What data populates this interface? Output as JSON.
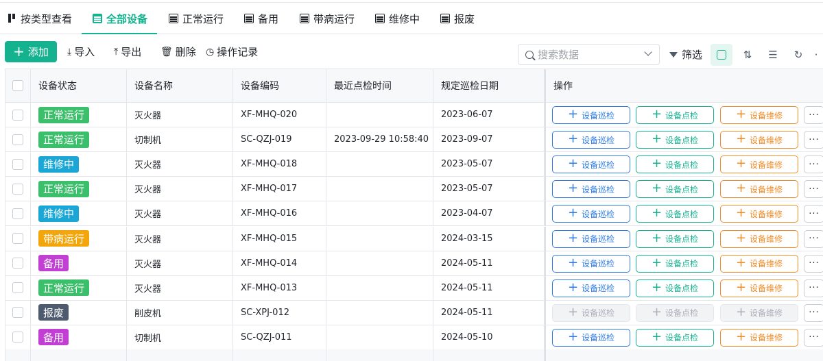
{
  "tabs": [
    {
      "label": "按类型查看",
      "icon": "kanban-icon",
      "active": false
    },
    {
      "label": "全部设备",
      "icon": "table-icon",
      "active": true
    },
    {
      "label": "正常运行",
      "icon": "table-icon",
      "active": false
    },
    {
      "label": "备用",
      "icon": "table-icon",
      "active": false
    },
    {
      "label": "带病运行",
      "icon": "table-icon",
      "active": false
    },
    {
      "label": "维修中",
      "icon": "table-icon",
      "active": false
    },
    {
      "label": "报废",
      "icon": "table-icon",
      "active": false
    }
  ],
  "toolbar": {
    "add_label": "添加",
    "import_label": "导入",
    "export_label": "导出",
    "delete_label": "删除",
    "log_label": "操作记录",
    "search_placeholder": "搜索数据",
    "filter_label": "筛选"
  },
  "columns": [
    "设备状态",
    "设备名称",
    "设备编码",
    "最近点检时间",
    "规定巡检日期",
    "操作"
  ],
  "actions": {
    "inspect": "设备巡检",
    "check": "设备点检",
    "repair": "设备维修",
    "more": "···"
  },
  "colors": {
    "accent": "#15b28f",
    "status_normal": "#3cbf6b",
    "status_repair": "#1aa7d6",
    "status_sick": "#f2a60c",
    "status_spare": "#c23fd4",
    "status_scrap": "#4e5a6e"
  },
  "rows": [
    {
      "status": "正常运行",
      "status_color": "#3cbf6b",
      "name": "灭火器",
      "code": "XF-MHQ-020",
      "last_check": "",
      "due_date": "2023-06-07",
      "disabled": false
    },
    {
      "status": "正常运行",
      "status_color": "#3cbf6b",
      "name": "切制机",
      "code": "SC-QZJ-019",
      "last_check": "2023-09-29 10:58:40",
      "due_date": "2023-09-07",
      "disabled": false
    },
    {
      "status": "维修中",
      "status_color": "#1aa7d6",
      "name": "灭火器",
      "code": "XF-MHQ-018",
      "last_check": "",
      "due_date": "2023-05-07",
      "disabled": false
    },
    {
      "status": "正常运行",
      "status_color": "#3cbf6b",
      "name": "灭火器",
      "code": "XF-MHQ-017",
      "last_check": "",
      "due_date": "2023-05-07",
      "disabled": false
    },
    {
      "status": "维修中",
      "status_color": "#1aa7d6",
      "name": "灭火器",
      "code": "XF-MHQ-016",
      "last_check": "",
      "due_date": "2023-04-07",
      "disabled": false
    },
    {
      "status": "带病运行",
      "status_color": "#f2a60c",
      "name": "灭火器",
      "code": "XF-MHQ-015",
      "last_check": "",
      "due_date": "2024-03-15",
      "disabled": false
    },
    {
      "status": "备用",
      "status_color": "#c23fd4",
      "name": "灭火器",
      "code": "XF-MHQ-014",
      "last_check": "",
      "due_date": "2024-05-11",
      "disabled": false
    },
    {
      "status": "正常运行",
      "status_color": "#3cbf6b",
      "name": "灭火器",
      "code": "XF-MHQ-013",
      "last_check": "",
      "due_date": "2024-05-11",
      "disabled": false
    },
    {
      "status": "报废",
      "status_color": "#4e5a6e",
      "name": "削皮机",
      "code": "SC-XPJ-012",
      "last_check": "",
      "due_date": "2024-05-11",
      "disabled": true
    },
    {
      "status": "备用",
      "status_color": "#c23fd4",
      "name": "切制机",
      "code": "SC-QZJ-011",
      "last_check": "",
      "due_date": "2024-05-10",
      "disabled": false
    }
  ]
}
